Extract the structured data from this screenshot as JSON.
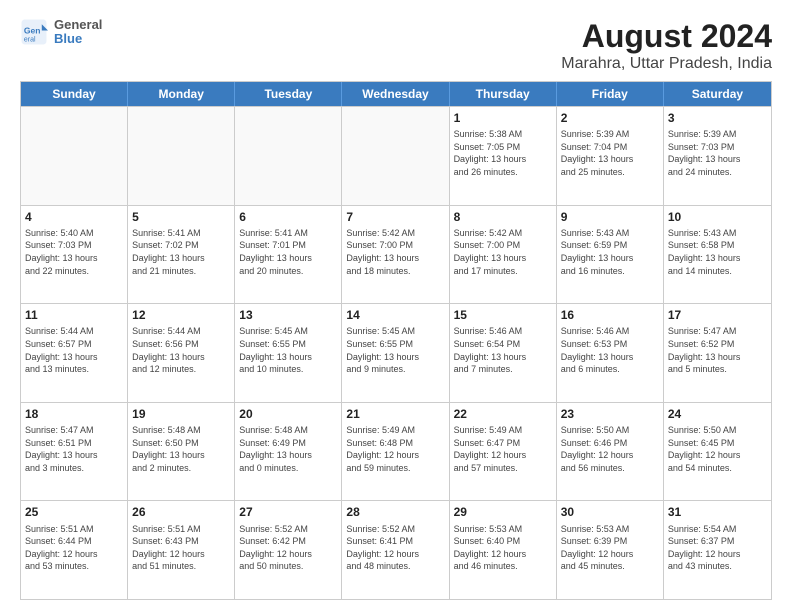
{
  "logo": {
    "line1": "General",
    "line2": "Blue"
  },
  "title": "August 2024",
  "subtitle": "Marahra, Uttar Pradesh, India",
  "weekdays": [
    "Sunday",
    "Monday",
    "Tuesday",
    "Wednesday",
    "Thursday",
    "Friday",
    "Saturday"
  ],
  "weeks": [
    [
      {
        "day": "",
        "info": "",
        "empty": true
      },
      {
        "day": "",
        "info": "",
        "empty": true
      },
      {
        "day": "",
        "info": "",
        "empty": true
      },
      {
        "day": "",
        "info": "",
        "empty": true
      },
      {
        "day": "1",
        "info": "Sunrise: 5:38 AM\nSunset: 7:05 PM\nDaylight: 13 hours\nand 26 minutes.",
        "empty": false
      },
      {
        "day": "2",
        "info": "Sunrise: 5:39 AM\nSunset: 7:04 PM\nDaylight: 13 hours\nand 25 minutes.",
        "empty": false
      },
      {
        "day": "3",
        "info": "Sunrise: 5:39 AM\nSunset: 7:03 PM\nDaylight: 13 hours\nand 24 minutes.",
        "empty": false
      }
    ],
    [
      {
        "day": "4",
        "info": "Sunrise: 5:40 AM\nSunset: 7:03 PM\nDaylight: 13 hours\nand 22 minutes.",
        "empty": false
      },
      {
        "day": "5",
        "info": "Sunrise: 5:41 AM\nSunset: 7:02 PM\nDaylight: 13 hours\nand 21 minutes.",
        "empty": false
      },
      {
        "day": "6",
        "info": "Sunrise: 5:41 AM\nSunset: 7:01 PM\nDaylight: 13 hours\nand 20 minutes.",
        "empty": false
      },
      {
        "day": "7",
        "info": "Sunrise: 5:42 AM\nSunset: 7:00 PM\nDaylight: 13 hours\nand 18 minutes.",
        "empty": false
      },
      {
        "day": "8",
        "info": "Sunrise: 5:42 AM\nSunset: 7:00 PM\nDaylight: 13 hours\nand 17 minutes.",
        "empty": false
      },
      {
        "day": "9",
        "info": "Sunrise: 5:43 AM\nSunset: 6:59 PM\nDaylight: 13 hours\nand 16 minutes.",
        "empty": false
      },
      {
        "day": "10",
        "info": "Sunrise: 5:43 AM\nSunset: 6:58 PM\nDaylight: 13 hours\nand 14 minutes.",
        "empty": false
      }
    ],
    [
      {
        "day": "11",
        "info": "Sunrise: 5:44 AM\nSunset: 6:57 PM\nDaylight: 13 hours\nand 13 minutes.",
        "empty": false
      },
      {
        "day": "12",
        "info": "Sunrise: 5:44 AM\nSunset: 6:56 PM\nDaylight: 13 hours\nand 12 minutes.",
        "empty": false
      },
      {
        "day": "13",
        "info": "Sunrise: 5:45 AM\nSunset: 6:55 PM\nDaylight: 13 hours\nand 10 minutes.",
        "empty": false
      },
      {
        "day": "14",
        "info": "Sunrise: 5:45 AM\nSunset: 6:55 PM\nDaylight: 13 hours\nand 9 minutes.",
        "empty": false
      },
      {
        "day": "15",
        "info": "Sunrise: 5:46 AM\nSunset: 6:54 PM\nDaylight: 13 hours\nand 7 minutes.",
        "empty": false
      },
      {
        "day": "16",
        "info": "Sunrise: 5:46 AM\nSunset: 6:53 PM\nDaylight: 13 hours\nand 6 minutes.",
        "empty": false
      },
      {
        "day": "17",
        "info": "Sunrise: 5:47 AM\nSunset: 6:52 PM\nDaylight: 13 hours\nand 5 minutes.",
        "empty": false
      }
    ],
    [
      {
        "day": "18",
        "info": "Sunrise: 5:47 AM\nSunset: 6:51 PM\nDaylight: 13 hours\nand 3 minutes.",
        "empty": false
      },
      {
        "day": "19",
        "info": "Sunrise: 5:48 AM\nSunset: 6:50 PM\nDaylight: 13 hours\nand 2 minutes.",
        "empty": false
      },
      {
        "day": "20",
        "info": "Sunrise: 5:48 AM\nSunset: 6:49 PM\nDaylight: 13 hours\nand 0 minutes.",
        "empty": false
      },
      {
        "day": "21",
        "info": "Sunrise: 5:49 AM\nSunset: 6:48 PM\nDaylight: 12 hours\nand 59 minutes.",
        "empty": false
      },
      {
        "day": "22",
        "info": "Sunrise: 5:49 AM\nSunset: 6:47 PM\nDaylight: 12 hours\nand 57 minutes.",
        "empty": false
      },
      {
        "day": "23",
        "info": "Sunrise: 5:50 AM\nSunset: 6:46 PM\nDaylight: 12 hours\nand 56 minutes.",
        "empty": false
      },
      {
        "day": "24",
        "info": "Sunrise: 5:50 AM\nSunset: 6:45 PM\nDaylight: 12 hours\nand 54 minutes.",
        "empty": false
      }
    ],
    [
      {
        "day": "25",
        "info": "Sunrise: 5:51 AM\nSunset: 6:44 PM\nDaylight: 12 hours\nand 53 minutes.",
        "empty": false
      },
      {
        "day": "26",
        "info": "Sunrise: 5:51 AM\nSunset: 6:43 PM\nDaylight: 12 hours\nand 51 minutes.",
        "empty": false
      },
      {
        "day": "27",
        "info": "Sunrise: 5:52 AM\nSunset: 6:42 PM\nDaylight: 12 hours\nand 50 minutes.",
        "empty": false
      },
      {
        "day": "28",
        "info": "Sunrise: 5:52 AM\nSunset: 6:41 PM\nDaylight: 12 hours\nand 48 minutes.",
        "empty": false
      },
      {
        "day": "29",
        "info": "Sunrise: 5:53 AM\nSunset: 6:40 PM\nDaylight: 12 hours\nand 46 minutes.",
        "empty": false
      },
      {
        "day": "30",
        "info": "Sunrise: 5:53 AM\nSunset: 6:39 PM\nDaylight: 12 hours\nand 45 minutes.",
        "empty": false
      },
      {
        "day": "31",
        "info": "Sunrise: 5:54 AM\nSunset: 6:37 PM\nDaylight: 12 hours\nand 43 minutes.",
        "empty": false
      }
    ]
  ]
}
